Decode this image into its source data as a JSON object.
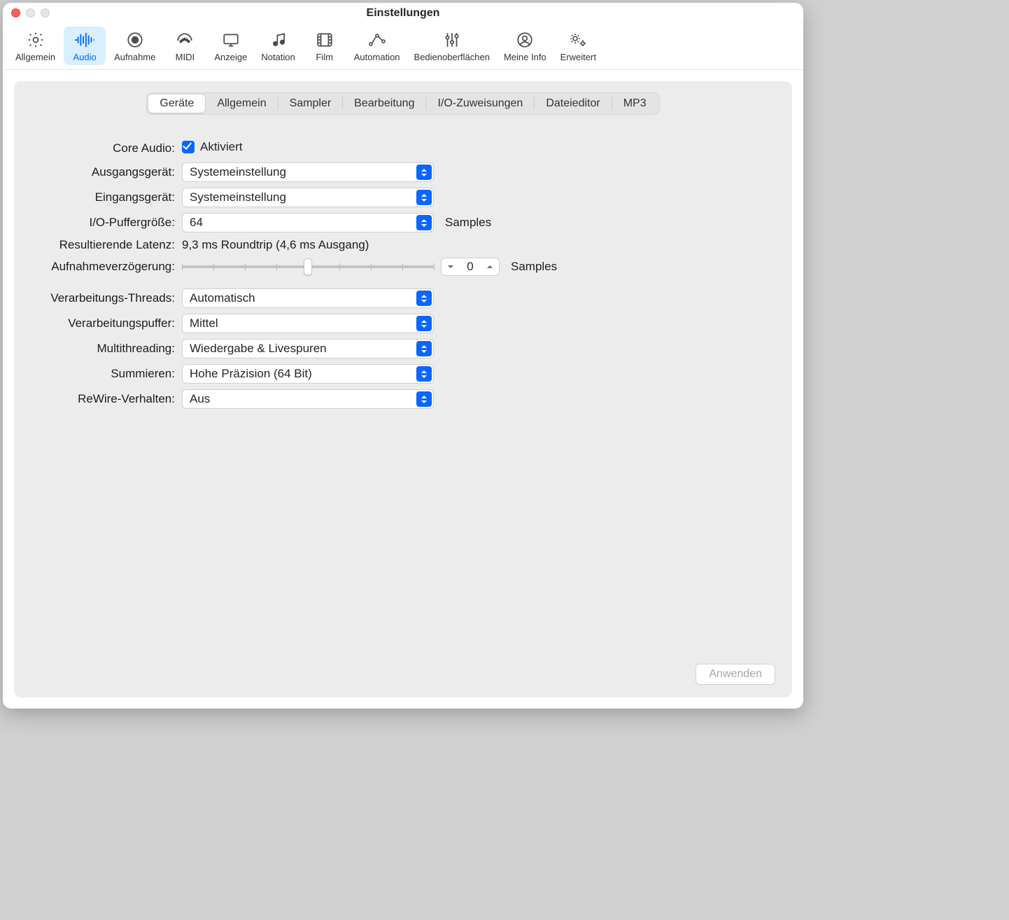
{
  "window": {
    "title": "Einstellungen"
  },
  "toolbar": {
    "items": [
      {
        "label": "Allgemein"
      },
      {
        "label": "Audio"
      },
      {
        "label": "Aufnahme"
      },
      {
        "label": "MIDI"
      },
      {
        "label": "Anzeige"
      },
      {
        "label": "Notation"
      },
      {
        "label": "Film"
      },
      {
        "label": "Automation"
      },
      {
        "label": "Bedienoberflächen"
      },
      {
        "label": "Meine Info"
      },
      {
        "label": "Erweitert"
      }
    ],
    "selected_index": 1
  },
  "tabs": {
    "items": [
      {
        "label": "Geräte"
      },
      {
        "label": "Allgemein"
      },
      {
        "label": "Sampler"
      },
      {
        "label": "Bearbeitung"
      },
      {
        "label": "I/O-Zuweisungen"
      },
      {
        "label": "Dateieditor"
      },
      {
        "label": "MP3"
      }
    ],
    "selected_index": 0
  },
  "form": {
    "core_audio": {
      "label": "Core Audio",
      "checkbox_label": "Aktiviert",
      "checked": true
    },
    "output_device": {
      "label": "Ausgangsgerät",
      "value": "Systemeinstellung"
    },
    "input_device": {
      "label": "Eingangsgerät",
      "value": "Systemeinstellung"
    },
    "buffer": {
      "label": "I/O-Puffergröße",
      "value": "64",
      "unit": "Samples"
    },
    "latency": {
      "label": "Resultierende Latenz",
      "value": "9,3 ms Roundtrip (4,6 ms Ausgang)"
    },
    "rec_delay": {
      "label": "Aufnahmeverzögerung",
      "value": "0",
      "unit": "Samples"
    },
    "threads": {
      "label": "Verarbeitungs-Threads",
      "value": "Automatisch"
    },
    "proc_buf": {
      "label": "Verarbeitungspuffer",
      "value": "Mittel"
    },
    "multithreading": {
      "label": "Multithreading",
      "value": "Wiedergabe & Livespuren"
    },
    "summing": {
      "label": "Summieren",
      "value": "Hohe Präzision (64 Bit)"
    },
    "rewire": {
      "label": "ReWire-Verhalten",
      "value": "Aus"
    }
  },
  "apply_button": "Anwenden"
}
